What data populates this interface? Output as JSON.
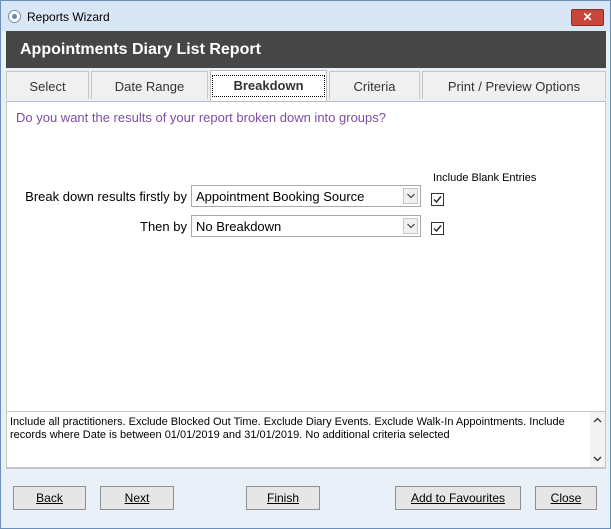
{
  "window": {
    "title": "Reports Wizard",
    "close_label": "✕"
  },
  "header": {
    "title": "Appointments Diary List Report"
  },
  "tabs": [
    {
      "label": "Select"
    },
    {
      "label": "Date Range"
    },
    {
      "label": "Breakdown"
    },
    {
      "label": "Criteria"
    },
    {
      "label": "Print / Preview Options"
    }
  ],
  "breakdown": {
    "question": "Do you want the results of your report broken down into groups?",
    "include_blank_label": "Include Blank Entries",
    "first_label": "Break down results firstly by",
    "first_value": "Appointment Booking Source",
    "first_blank_checked": true,
    "second_label": "Then by",
    "second_value": "No Breakdown",
    "second_blank_checked": true
  },
  "summary": {
    "text": "Include all practitioners. Exclude Blocked Out Time. Exclude Diary Events. Exclude Walk-In Appointments. Include records where Date is between 01/01/2019 and 31/01/2019. No additional criteria selected"
  },
  "buttons": {
    "back": "Back",
    "next": "Next",
    "finish": "Finish",
    "add_favourites": "Add to Favourites",
    "close": "Close"
  },
  "colors": {
    "header_bg": "#464646",
    "question_text": "#7b4fa3",
    "close_btn": "#c8463a"
  }
}
